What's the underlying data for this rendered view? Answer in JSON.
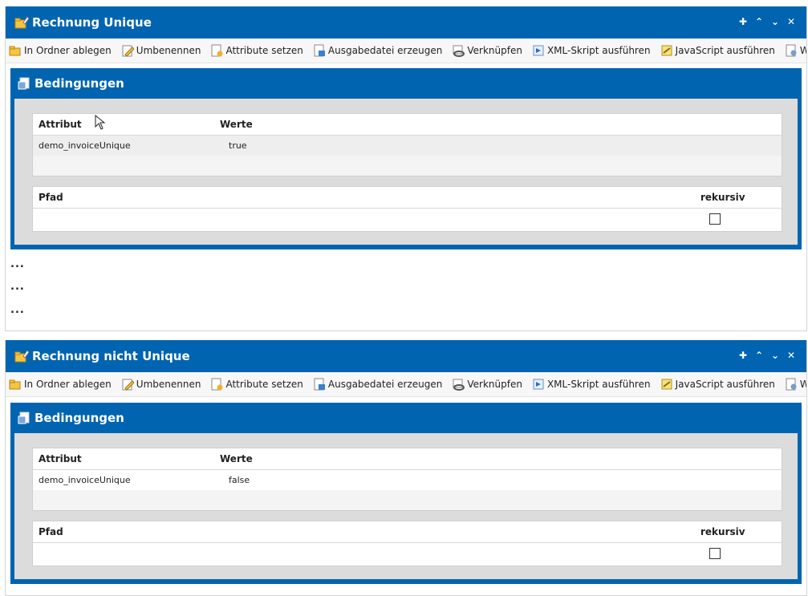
{
  "panels": [
    {
      "title": "Rechnung Unique",
      "toolbar": [
        "In Ordner ablegen",
        "Umbenennen",
        "Attribute setzen",
        "Ausgabedatei erzeugen",
        "Verknüpfen",
        "XML-Skript ausführen",
        "JavaScript ausführen",
        "Workflow"
      ],
      "section_title": "Bedingungen",
      "attr_header": "Attribut",
      "values_header": "Werte",
      "attribute": "demo_invoiceUnique",
      "value": "true",
      "path_header": "Pfad",
      "recursive_header": "rekursiv",
      "ellipses": [
        "...",
        "...",
        "..."
      ]
    },
    {
      "title": "Rechnung nicht Unique",
      "toolbar": [
        "In Ordner ablegen",
        "Umbenennen",
        "Attribute setzen",
        "Ausgabedatei erzeugen",
        "Verknüpfen",
        "XML-Skript ausführen",
        "JavaScript ausführen",
        "Workflow"
      ],
      "section_title": "Bedingungen",
      "attr_header": "Attribut",
      "values_header": "Werte",
      "attribute": "demo_invoiceUnique",
      "value": "false",
      "path_header": "Pfad",
      "recursive_header": "rekursiv"
    }
  ],
  "window_tools": [
    "add-icon",
    "collapse-all-icon",
    "expand-all-icon",
    "close-icon"
  ],
  "colors": {
    "accent": "#0064b0",
    "toolbar_bg": "#f7f7f7",
    "inner_bg": "#dcdcdc"
  }
}
